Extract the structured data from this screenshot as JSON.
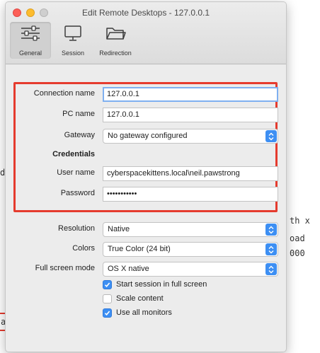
{
  "window": {
    "title": "Edit Remote Desktops - 127.0.0.1"
  },
  "toolbar": {
    "items": [
      {
        "label": "General",
        "icon": "sliders-icon",
        "active": true
      },
      {
        "label": "Session",
        "icon": "display-icon",
        "active": false
      },
      {
        "label": "Redirection",
        "icon": "folder-icon",
        "active": false
      }
    ]
  },
  "form": {
    "connection_name": {
      "label": "Connection name",
      "value": "127.0.0.1"
    },
    "pc_name": {
      "label": "PC name",
      "value": "127.0.0.1"
    },
    "gateway": {
      "label": "Gateway",
      "value": "No gateway configured"
    },
    "credentials_heading": "Credentials",
    "user_name": {
      "label": "User name",
      "value": "cyberspacekittens.local\\neil.pawstrong"
    },
    "password": {
      "label": "Password",
      "value": "•••••••••••"
    },
    "resolution": {
      "label": "Resolution",
      "value": "Native"
    },
    "colors": {
      "label": "Colors",
      "value": "True Color (24 bit)"
    },
    "full_screen_mode": {
      "label": "Full screen mode",
      "value": "OS X native"
    },
    "checks": [
      {
        "label": "Start session in full screen",
        "checked": true
      },
      {
        "label": "Scale content",
        "checked": false
      },
      {
        "label": "Use all monitors",
        "checked": true
      }
    ]
  },
  "background": {
    "frag_d": "d",
    "frag_1": "th x",
    "frag_2": "oad",
    "frag_3": "000",
    "frag_red": "a"
  },
  "colors": {
    "highlight_box": "#e53b2e",
    "accent": "#3d8ff3"
  }
}
